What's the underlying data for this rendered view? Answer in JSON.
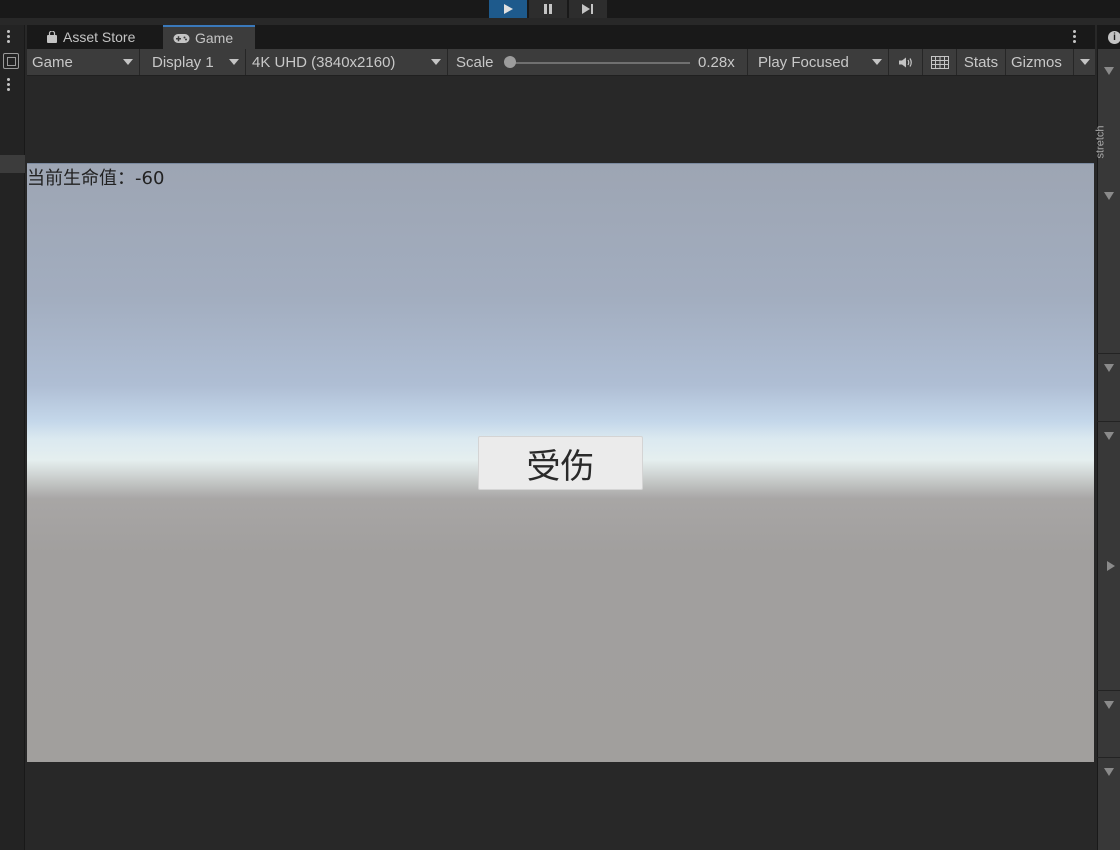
{
  "tabs": [
    {
      "label": "Asset Store",
      "icon": "bag-icon"
    },
    {
      "label": "Game",
      "icon": "gamepad-icon",
      "active": true
    }
  ],
  "toolbar": {
    "view_mode": "Game",
    "display": "Display 1",
    "resolution": "4K UHD (3840x2160)",
    "scale_label": "Scale",
    "scale_value": "0.28x",
    "play_mode": "Play Focused",
    "stats": "Stats",
    "gizmos": "Gizmos"
  },
  "game": {
    "health_text": "当前生命值：-60",
    "hurt_button": "受伤"
  },
  "right_panel": {
    "stretch_label": "stretch"
  },
  "colors": {
    "accent_play": "#1e5a8c",
    "tab_active_border": "#3a79bb"
  }
}
